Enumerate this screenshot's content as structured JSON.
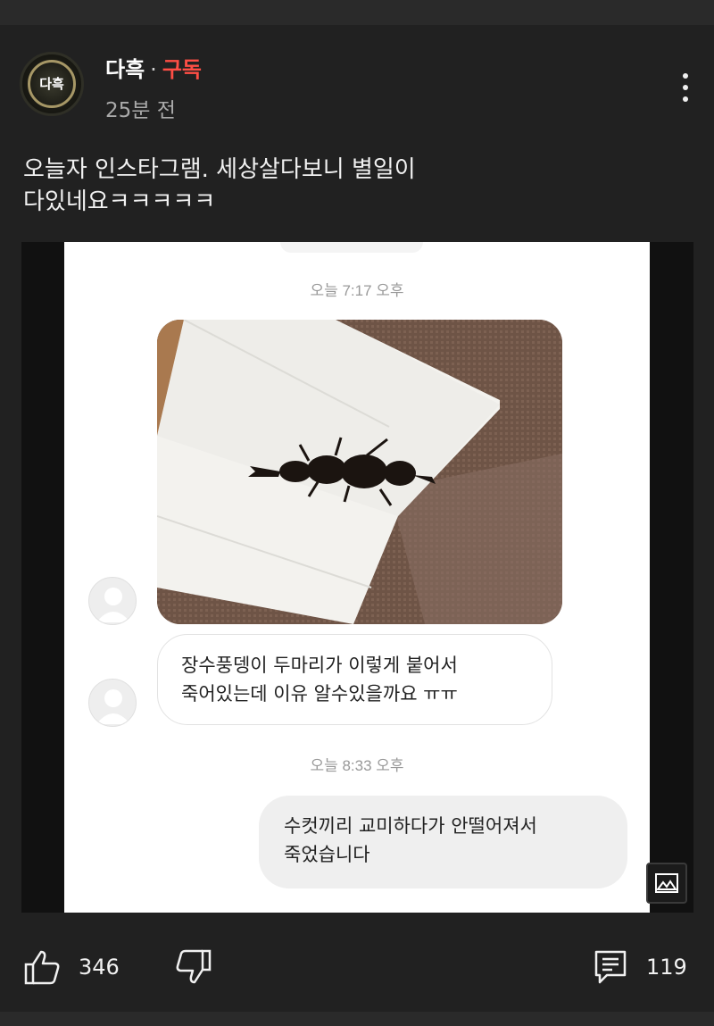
{
  "channel": {
    "name": "다흑",
    "separator": "·",
    "subscribe_label": "구독",
    "avatar_text": "다흑",
    "posted_time": "25분 전"
  },
  "post": {
    "text_lines": [
      "오늘자 인스타그램. 세상살다보니 별일이",
      "다있네요ㅋㅋㅋㅋㅋ"
    ]
  },
  "chat": {
    "stamp_1": "오늘 7:17 오후",
    "incoming_lines": [
      "장수풍뎅이 두마리가 이렇게 붙어서",
      "죽어있는데 이유 알수있을까요 ㅠㅠ"
    ],
    "stamp_2": "오늘 8:33 오후",
    "outgoing_lines": [
      "수컷끼리 교미하다가 안떨어져서",
      "죽었습니다"
    ]
  },
  "actions": {
    "likes": "346",
    "comments": "119"
  },
  "icons": {
    "more": "more-vertical-icon",
    "like": "thumbs-up-icon",
    "dislike": "thumbs-down-icon",
    "comment": "comment-icon",
    "image": "image-icon"
  },
  "colors": {
    "background": "#212121",
    "subscribe_accent": "#ff4e45",
    "muted_text": "#aaaaaa"
  }
}
